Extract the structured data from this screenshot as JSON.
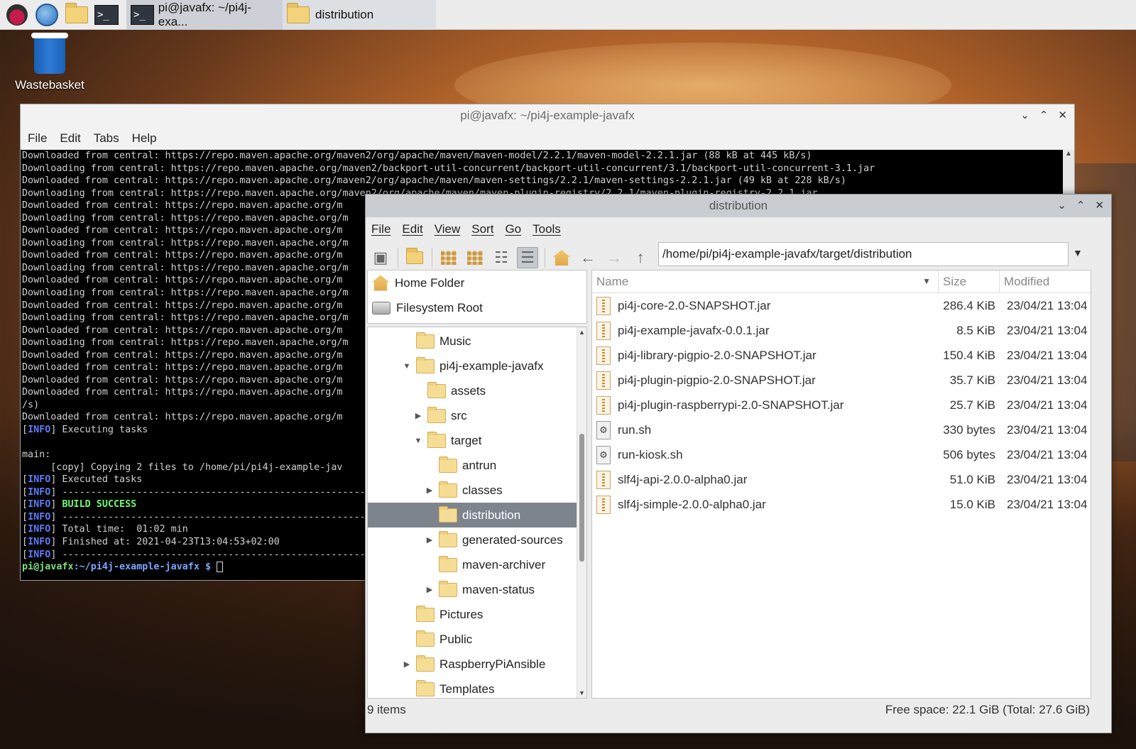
{
  "taskbar": {
    "icons": [
      "raspberry-pi-menu-icon",
      "web-browser-icon",
      "file-manager-icon",
      "terminal-icon"
    ],
    "tasks": [
      {
        "label": "pi@javafx: ~/pi4j-exa...",
        "icon": "terminal-icon"
      },
      {
        "label": "distribution",
        "icon": "folder-icon"
      }
    ]
  },
  "desktop": {
    "icons": [
      {
        "label": "Wastebasket",
        "icon": "wastebasket-icon"
      }
    ]
  },
  "terminal": {
    "title": "pi@javafx: ~/pi4j-example-javafx",
    "menu": [
      "File",
      "Edit",
      "Tabs",
      "Help"
    ],
    "lines": [
      "Downloaded from central: https://repo.maven.apache.org/maven2/org/apache/maven/maven-model/2.2.1/maven-model-2.2.1.jar (88 kB at 445 kB/s)",
      "Downloading from central: https://repo.maven.apache.org/maven2/backport-util-concurrent/backport-util-concurrent/3.1/backport-util-concurrent-3.1.jar",
      "Downloaded from central: https://repo.maven.apache.org/maven2/org/apache/maven/maven-settings/2.2.1/maven-settings-2.2.1.jar (49 kB at 228 kB/s)",
      "Downloading from central: https://repo.maven.apache.org/maven2/org/apache/maven/maven-plugin-registry/2.2.1/maven-plugin-registry-2.2.1.jar",
      "Downloaded from central: https://repo.maven.apache.org/m",
      "Downloading from central: https://repo.maven.apache.org/m",
      "Downloaded from central: https://repo.maven.apache.org/m",
      "Downloading from central: https://repo.maven.apache.org/m",
      "Downloaded from central: https://repo.maven.apache.org/m",
      "Downloading from central: https://repo.maven.apache.org/m",
      "Downloaded from central: https://repo.maven.apache.org/m",
      "Downloading from central: https://repo.maven.apache.org/m",
      "Downloaded from central: https://repo.maven.apache.org/m",
      "Downloading from central: https://repo.maven.apache.org/m",
      "Downloaded from central: https://repo.maven.apache.org/m",
      "Downloading from central: https://repo.maven.apache.org/m",
      "Downloaded from central: https://repo.maven.apache.org/m",
      "Downloaded from central: https://repo.maven.apache.org/m",
      "Downloaded from central: https://repo.maven.apache.org/m",
      "Downloaded from central: https://repo.maven.apache.org/m",
      "/s)",
      "Downloaded from central: https://repo.maven.apache.org/m"
    ],
    "info_tag": "INFO",
    "executing": " Executing tasks",
    "main_label": "main:",
    "copy_line": "     [copy] Copying 2 files to /home/pi/pi4j-example-jav",
    "executed": " Executed tasks",
    "dashes": " ------------------------------------------------------------------------",
    "build_success": "BUILD SUCCESS",
    "total_time": " Total time:  01:02 min",
    "finished_at": " Finished at: 2021-04-23T13:04:53+02:00",
    "prompt_user": "pi@javafx",
    "prompt_path": ":~/pi4j-example-javafx $ "
  },
  "file_manager": {
    "title": "distribution",
    "menu": [
      "File",
      "Edit",
      "View",
      "Sort",
      "Go",
      "Tools"
    ],
    "path": "/home/pi/pi4j-example-javafx/target/distribution",
    "places": [
      {
        "label": "Home Folder",
        "icon": "home-icon"
      },
      {
        "label": "Filesystem Root",
        "icon": "drive-icon"
      }
    ],
    "tree": [
      {
        "label": "Music",
        "indent": 0,
        "expander": ""
      },
      {
        "label": "pi4j-example-javafx",
        "indent": 0,
        "expander": "▼"
      },
      {
        "label": "assets",
        "indent": 1,
        "expander": ""
      },
      {
        "label": "src",
        "indent": 1,
        "expander": "▶"
      },
      {
        "label": "target",
        "indent": 1,
        "expander": "▼"
      },
      {
        "label": "antrun",
        "indent": 2,
        "expander": ""
      },
      {
        "label": "classes",
        "indent": 2,
        "expander": "▶"
      },
      {
        "label": "distribution",
        "indent": 2,
        "expander": "",
        "selected": true
      },
      {
        "label": "generated-sources",
        "indent": 2,
        "expander": "▶"
      },
      {
        "label": "maven-archiver",
        "indent": 2,
        "expander": ""
      },
      {
        "label": "maven-status",
        "indent": 2,
        "expander": "▶"
      },
      {
        "label": "Pictures",
        "indent": 0,
        "expander": ""
      },
      {
        "label": "Public",
        "indent": 0,
        "expander": ""
      },
      {
        "label": "RaspberryPiAnsible",
        "indent": 0,
        "expander": "▶"
      },
      {
        "label": "Templates",
        "indent": 0,
        "expander": ""
      }
    ],
    "columns": {
      "name": "Name",
      "size": "Size",
      "modified": "Modified"
    },
    "files": [
      {
        "name": "pi4j-core-2.0-SNAPSHOT.jar",
        "size": "286.4 KiB",
        "modified": "23/04/21 13:04",
        "type": "jar"
      },
      {
        "name": "pi4j-example-javafx-0.0.1.jar",
        "size": "8.5 KiB",
        "modified": "23/04/21 13:04",
        "type": "jar"
      },
      {
        "name": "pi4j-library-pigpio-2.0-SNAPSHOT.jar",
        "size": "150.4 KiB",
        "modified": "23/04/21 13:04",
        "type": "jar"
      },
      {
        "name": "pi4j-plugin-pigpio-2.0-SNAPSHOT.jar",
        "size": "35.7 KiB",
        "modified": "23/04/21 13:04",
        "type": "jar"
      },
      {
        "name": "pi4j-plugin-raspberrypi-2.0-SNAPSHOT.jar",
        "size": "25.7 KiB",
        "modified": "23/04/21 13:04",
        "type": "jar"
      },
      {
        "name": "run.sh",
        "size": "330 bytes",
        "modified": "23/04/21 13:04",
        "type": "sh"
      },
      {
        "name": "run-kiosk.sh",
        "size": "506 bytes",
        "modified": "23/04/21 13:04",
        "type": "sh"
      },
      {
        "name": "slf4j-api-2.0.0-alpha0.jar",
        "size": "51.0 KiB",
        "modified": "23/04/21 13:04",
        "type": "jar"
      },
      {
        "name": "slf4j-simple-2.0.0-alpha0.jar",
        "size": "15.0 KiB",
        "modified": "23/04/21 13:04",
        "type": "jar"
      }
    ],
    "status_left": "9 items",
    "status_right": "Free space: 22.1 GiB (Total: 27.6 GiB)"
  }
}
